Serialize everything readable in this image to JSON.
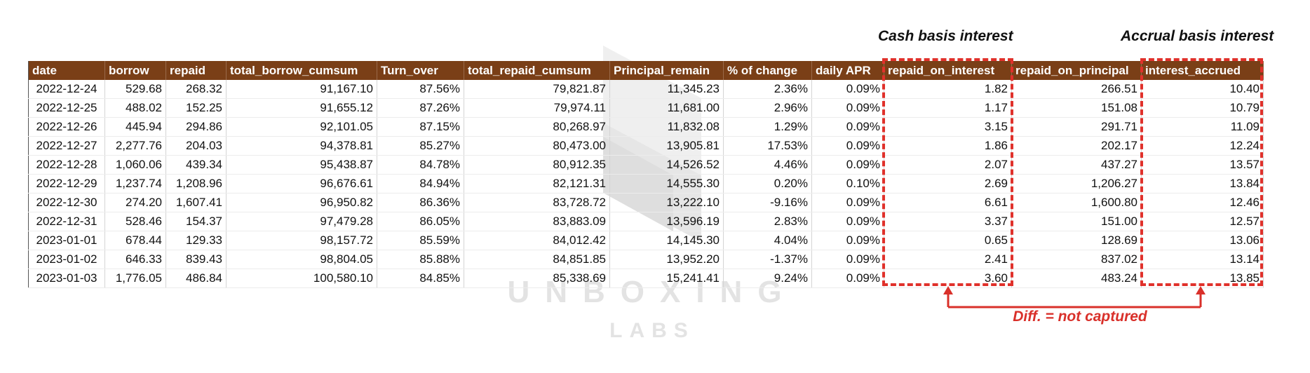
{
  "watermark": {
    "main": "UNBOXING",
    "sub": "LABS"
  },
  "annotations": {
    "cash_basis_label": "Cash basis interest",
    "accrual_basis_label": "Accrual basis interest",
    "diff_label": "Diff. = not captured"
  },
  "colors": {
    "header_bg": "#7a3f17",
    "highlight_box": "#e0312b"
  },
  "table": {
    "headers": [
      "date",
      "borrow",
      "repaid",
      "total_borrow_cumsum",
      "Turn_over",
      "total_repaid_cumsum",
      "Principal_remain",
      "% of change",
      "daily APR",
      "repaid_on_interest",
      "repaid_on_principal",
      "interest_accrued"
    ],
    "rows": [
      [
        "2022-12-24",
        "529.68",
        "268.32",
        "91,167.10",
        "87.56%",
        "79,821.87",
        "11,345.23",
        "2.36%",
        "0.09%",
        "1.82",
        "266.51",
        "10.40"
      ],
      [
        "2022-12-25",
        "488.02",
        "152.25",
        "91,655.12",
        "87.26%",
        "79,974.11",
        "11,681.00",
        "2.96%",
        "0.09%",
        "1.17",
        "151.08",
        "10.79"
      ],
      [
        "2022-12-26",
        "445.94",
        "294.86",
        "92,101.05",
        "87.15%",
        "80,268.97",
        "11,832.08",
        "1.29%",
        "0.09%",
        "3.15",
        "291.71",
        "11.09"
      ],
      [
        "2022-12-27",
        "2,277.76",
        "204.03",
        "94,378.81",
        "85.27%",
        "80,473.00",
        "13,905.81",
        "17.53%",
        "0.09%",
        "1.86",
        "202.17",
        "12.24"
      ],
      [
        "2022-12-28",
        "1,060.06",
        "439.34",
        "95,438.87",
        "84.78%",
        "80,912.35",
        "14,526.52",
        "4.46%",
        "0.09%",
        "2.07",
        "437.27",
        "13.57"
      ],
      [
        "2022-12-29",
        "1,237.74",
        "1,208.96",
        "96,676.61",
        "84.94%",
        "82,121.31",
        "14,555.30",
        "0.20%",
        "0.10%",
        "2.69",
        "1,206.27",
        "13.84"
      ],
      [
        "2022-12-30",
        "274.20",
        "1,607.41",
        "96,950.82",
        "86.36%",
        "83,728.72",
        "13,222.10",
        "-9.16%",
        "0.09%",
        "6.61",
        "1,600.80",
        "12.46"
      ],
      [
        "2022-12-31",
        "528.46",
        "154.37",
        "97,479.28",
        "86.05%",
        "83,883.09",
        "13,596.19",
        "2.83%",
        "0.09%",
        "3.37",
        "151.00",
        "12.57"
      ],
      [
        "2023-01-01",
        "678.44",
        "129.33",
        "98,157.72",
        "85.59%",
        "84,012.42",
        "14,145.30",
        "4.04%",
        "0.09%",
        "0.65",
        "128.69",
        "13.06"
      ],
      [
        "2023-01-02",
        "646.33",
        "839.43",
        "98,804.05",
        "85.88%",
        "84,851.85",
        "13,952.20",
        "-1.37%",
        "0.09%",
        "2.41",
        "837.02",
        "13.14"
      ],
      [
        "2023-01-03",
        "1,776.05",
        "486.84",
        "100,580.10",
        "84.85%",
        "85,338.69",
        "15,241.41",
        "9.24%",
        "0.09%",
        "3.60",
        "483.24",
        "13.85"
      ]
    ]
  }
}
